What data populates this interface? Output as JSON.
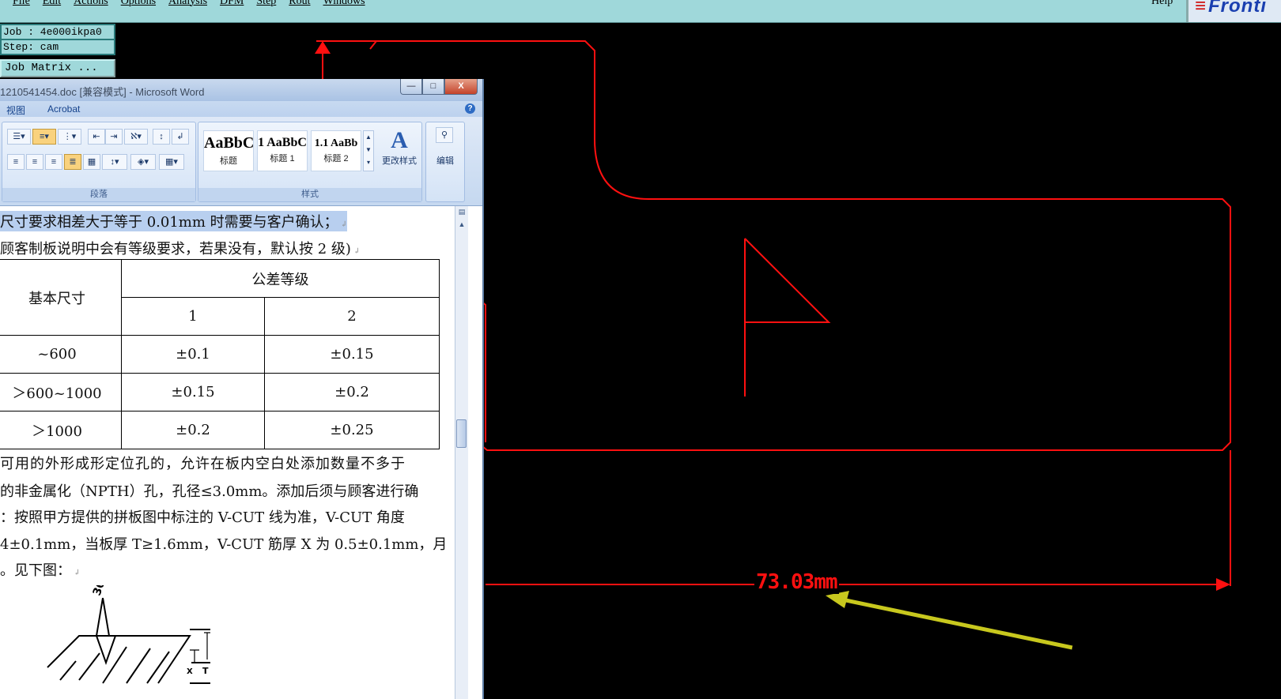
{
  "genesis": {
    "menu": [
      "File",
      "Edit",
      "Actions",
      "Options",
      "Analysis",
      "DFM",
      "Step",
      "Rout",
      "Windows"
    ],
    "help": "Help",
    "logo": "Fronti",
    "job_label": "Job : 4e000ikpa0",
    "step_label": "Step: cam",
    "job_matrix_button": "Job Matrix ..."
  },
  "cam_view": {
    "dimension_text": "73.03mm",
    "colors": {
      "outline": "#ff1010",
      "pointer_arrow": "#c8c81e",
      "background": "#000000"
    }
  },
  "word": {
    "title": "1210541454.doc [兼容模式] - Microsoft Word",
    "window_buttons": {
      "minimize": "—",
      "maximize": "□",
      "close": "X"
    },
    "tabs": [
      "视图",
      "Acrobat"
    ],
    "ribbon": {
      "paragraph_group": "段落",
      "styles_group": "样式",
      "styles": [
        {
          "sample": "AaBbC",
          "name": "标题"
        },
        {
          "sample": "1  AaBbC",
          "name": "标题 1"
        },
        {
          "sample": "1.1  AaBb",
          "name": "标题 2"
        }
      ],
      "change_styles": "更改样式",
      "editing": "编辑"
    },
    "document": {
      "line1": "尺寸要求相差大于等于 0.01mm 时需要与客户确认；",
      "line2": "顾客制板说明中会有等级要求，若果没有，默认按 2 级)",
      "table": {
        "header_basic": "基本尺寸",
        "header_grade": "公差等级",
        "grades": [
          "1",
          "2"
        ],
        "rows": [
          {
            "size": "~600",
            "g1": "±0.1",
            "g2": "±0.15"
          },
          {
            "size": "＞600~1000",
            "g1": "±0.15",
            "g2": "±0.2"
          },
          {
            "size": "＞1000",
            "g1": "±0.2",
            "g2": "±0.25"
          }
        ]
      },
      "line3": "可用的外形成形定位孔的，允许在板内空白处添加数量不多于",
      "line4": "的非金属化（NPTH）孔，孔径≤3.0mm。添加后须与顾客进行确",
      "line5": "：按照甲方提供的拼板图中标注的 V-CUT 线为准，V-CUT 角度",
      "line6": "4±0.1mm，当板厚 T≥1.6mm，V-CUT 筋厚 X 为 0.5±0.1mm，月",
      "line7": "。见下图：",
      "figure_angle": "30°",
      "figure_x": "X",
      "figure_t": "T"
    }
  }
}
